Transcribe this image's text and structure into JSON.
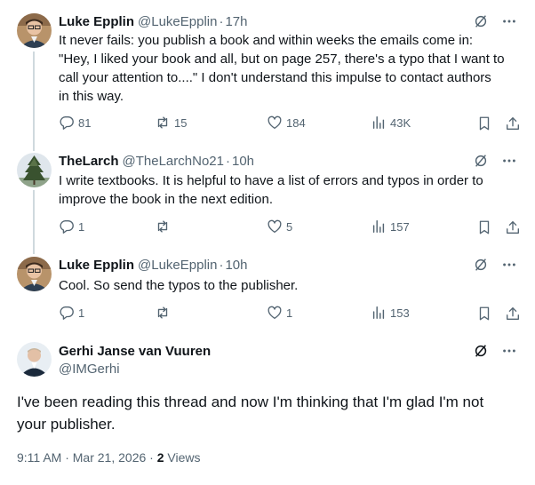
{
  "tweets": [
    {
      "name": "Luke Epplin",
      "handle": "@LukeEpplin",
      "time": "17h",
      "text_lines": [
        "It never fails: you publish a book and within weeks the emails come in:",
        "\"Hey, I liked your book and all, but on page 257, there's a typo that I want to",
        "call your attention to....\" I don't understand this impulse to contact authors",
        "in this way."
      ],
      "replies": "81",
      "reposts": "15",
      "likes": "184",
      "views": "43K"
    },
    {
      "name": "TheLarch",
      "handle": "@TheLarchNo21",
      "time": "10h",
      "text_lines": [
        "I write textbooks. It is helpful to have a list of errors and typos in order to",
        "improve the book in the next edition."
      ],
      "replies": "1",
      "reposts": "",
      "likes": "5",
      "views": "157"
    },
    {
      "name": "Luke Epplin",
      "handle": "@LukeEpplin",
      "time": "10h",
      "text_lines": [
        "Cool. So send the typos to the publisher."
      ],
      "replies": "1",
      "reposts": "",
      "likes": "1",
      "views": "153"
    }
  ],
  "main_tweet": {
    "name": "Gerhi Janse van Vuuren",
    "handle": "@IMGerhi",
    "text_lines": [
      "I've been reading this thread and now I'm thinking that I'm glad I'm not",
      "your publisher."
    ],
    "timestamp": "9:11 AM · Mar 21, 2026 · ",
    "views_count": "2",
    "views_label": " Views"
  },
  "separator": "·",
  "icons": [
    "grok-icon",
    "more-icon",
    "reply-icon",
    "repost-icon",
    "like-icon",
    "views-icon",
    "bookmark-icon",
    "share-icon"
  ]
}
